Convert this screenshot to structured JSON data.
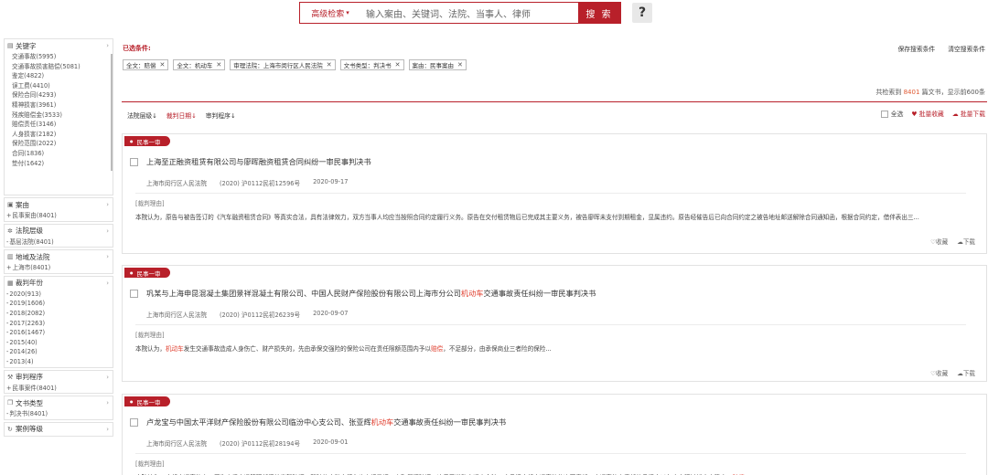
{
  "search": {
    "advanced_label": "高级检索",
    "advanced_arrow": "▾",
    "placeholder": "输入案由、关键词、法院、当事人、律师",
    "button_label": "搜 索",
    "help_label": "?"
  },
  "sidebar": {
    "keywords": {
      "title": "关键字",
      "items": [
        "交通事故(5995)",
        "交通事故损害赔偿(5081)",
        "鉴定(4822)",
        "误工费(4410)",
        "保险合同(4293)",
        "精神损害(3961)",
        "残疾赔偿金(3533)",
        "赔偿责任(3146)",
        "人身损害(2182)",
        "保险范围(2022)",
        "合同(1836)",
        "垫付(1642)"
      ]
    },
    "cause": {
      "title": "案由",
      "items": [
        "民事案由(8401)"
      ]
    },
    "court_level": {
      "title": "法院层级",
      "items": [
        "基层法院(8401)"
      ]
    },
    "region": {
      "title": "地域及法院",
      "items": [
        "上海市(8401)"
      ]
    },
    "year": {
      "title": "裁判年份",
      "items": [
        "2020(913)",
        "2019(1606)",
        "2018(2082)",
        "2017(2263)",
        "2016(1467)",
        "2015(40)",
        "2014(26)",
        "2013(4)"
      ]
    },
    "procedure": {
      "title": "审判程序",
      "items": [
        "民事案件(8401)"
      ]
    },
    "doc_type": {
      "title": "文书类型",
      "items": [
        "判决书(8401)"
      ]
    },
    "case_grade": {
      "title": "案例等级",
      "items": []
    }
  },
  "filters": {
    "label": "已选条件:",
    "tags": [
      "全文：赔偿",
      "全文：机动车",
      "审理法院：上海市闵行区人民法院",
      "文书类型：判决书",
      "案由：民事案由"
    ],
    "save_label": "保存搜索条件",
    "clear_label": "清空搜索条件"
  },
  "stats": {
    "prefix": "共检索到 ",
    "count": "8401",
    "suffix": " 篇文书，显示前600条"
  },
  "sorts": [
    "法院层级↓",
    "裁判日期↓",
    "审判程序↓"
  ],
  "bulk": {
    "select_all": "全选",
    "bulk_collect": "批量收藏",
    "bulk_download": "批量下载"
  },
  "results": [
    {
      "badge": "民事一审",
      "title_parts": [
        {
          "t": "上海至正融资租赁有限公司与廖晖融资租赁合同纠纷一审民事判决书",
          "hl": false
        }
      ],
      "court": "上海市闵行区人民法院",
      "case_no": "(2020) 沪0112民初12596号",
      "date": "2020-09-17",
      "reason_label": "[裁判理由]",
      "reason_parts": [
        {
          "t": "本院认为，原告与被告签订的《汽车融资租赁合同》等真实合法，具有法律效力，双方当事人均应当按照合同约定履行义务。原告在交付租赁物后已完成其主要义务，被告廖晖未支付到期租金，显属违约。原告经催告后已向合同约定之被告地址邮送解除合同通知函，根据合同约定，借伴表出三...",
          "hl": false
        }
      ],
      "collect": "收藏",
      "download": "下载"
    },
    {
      "badge": "民事一审",
      "title_parts": [
        {
          "t": "巩某与上海申昆混凝土集团景祥混凝土有限公司、中国人民财产保险股份有限公司上海市分公司",
          "hl": false
        },
        {
          "t": "机动车",
          "hl": true
        },
        {
          "t": "交通事故责任纠纷一审民事判决书",
          "hl": false
        }
      ],
      "court": "上海市闵行区人民法院",
      "case_no": "(2020) 沪0112民初26239号",
      "date": "2020-09-07",
      "reason_label": "[裁判理由]",
      "reason_parts": [
        {
          "t": "本院认为，",
          "hl": false
        },
        {
          "t": "机动车",
          "hl": true
        },
        {
          "t": "发生交通事故造成人身伤亡、财产损失的，先由承保交强险的保险公司在责任限额范围内予以",
          "hl": false
        },
        {
          "t": "赔偿",
          "hl": true
        },
        {
          "t": "，不足部分，由承保商业三者险的保险...",
          "hl": false
        }
      ],
      "collect": "收藏",
      "download": "下载"
    },
    {
      "badge": "民事一审",
      "title_parts": [
        {
          "t": "卢龙宝与中国太平洋财产保险股份有限公司临汾中心支公司、张亚辉",
          "hl": false
        },
        {
          "t": "机动车",
          "hl": true
        },
        {
          "t": "交通事故责任纠纷一审民事判决书",
          "hl": false
        }
      ],
      "court": "上海市闵行区人民法院",
      "case_no": "(2020) 沪0112民初28194号",
      "date": "2020-09-01",
      "reason_label": "[裁判理由]",
      "reason_parts": [
        {
          "t": "本院认为，本起交通事故中，原告未经交通管理部门核发驾驶证，驾驶的电动自行车也未经登记，未取得行驶证，违反了道路交通安全法，应承担本起交通事故的次要责任，交通事故中责任的承担应以各方实际过错大小确定，",
          "hl": false
        },
        {
          "t": "赔偿",
          "hl": true
        }
      ],
      "collect": "收藏",
      "download": "下载"
    }
  ]
}
